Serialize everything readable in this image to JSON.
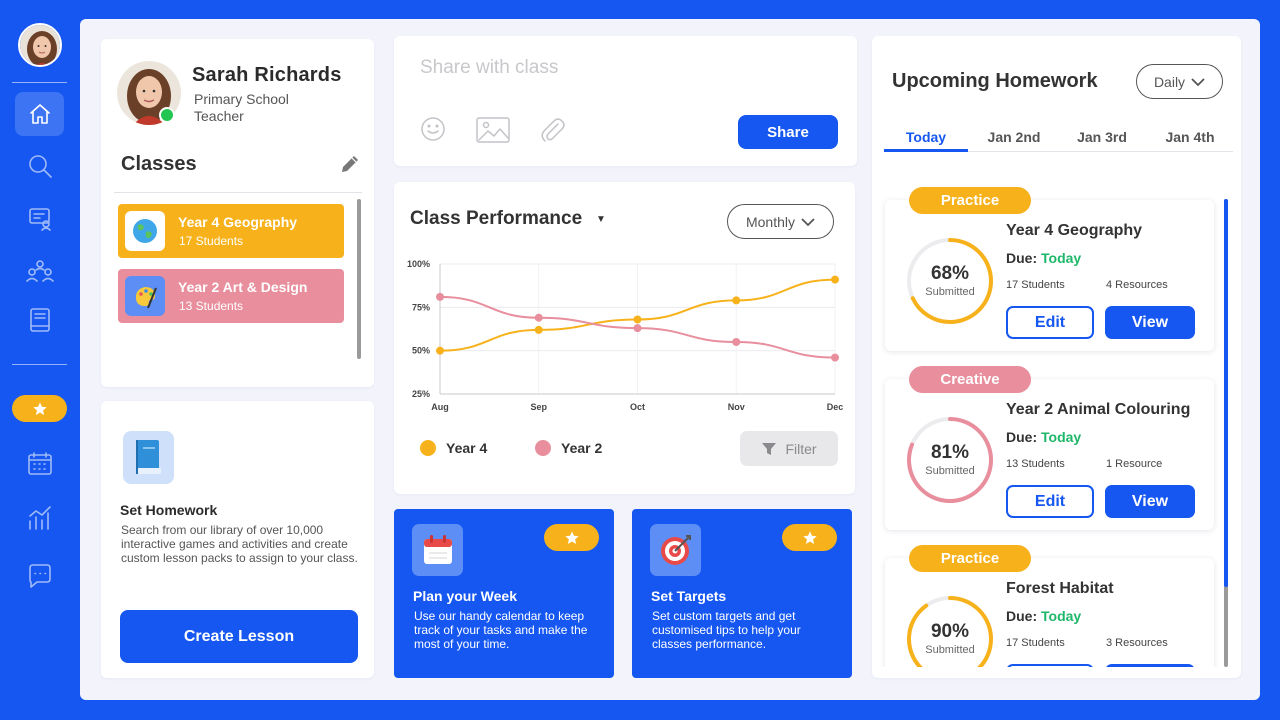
{
  "colors": {
    "brand": "#1557f0",
    "yellow": "#f7b21b",
    "pink": "#e88e9d",
    "green": "#1fb76a"
  },
  "sidebar": {
    "items": [
      {
        "icon": "home-icon",
        "active": true
      },
      {
        "icon": "search-icon",
        "active": false
      },
      {
        "icon": "classroom-icon",
        "active": false
      },
      {
        "icon": "students-icon",
        "active": false
      },
      {
        "icon": "book-icon",
        "active": false
      },
      {
        "icon": "calendar-icon",
        "active": false
      },
      {
        "icon": "analytics-icon",
        "active": false
      },
      {
        "icon": "chat-icon",
        "active": false
      }
    ]
  },
  "profile": {
    "name": "Sarah Richards",
    "role": "Primary School Teacher",
    "classes_title": "Classes",
    "classes": [
      {
        "name": "Year 4 Geography",
        "count": "17 Students",
        "color": "#f7b21b",
        "icon": "globe-icon"
      },
      {
        "name": "Year 2 Art & Design",
        "count": "13 Students",
        "color": "#e88e9d",
        "icon": "palette-icon"
      }
    ]
  },
  "homework_card": {
    "title": "Set Homework",
    "description": "Search from our library of over 10,000 interactive games and activities and create custom lesson packs to assign to your class.",
    "button": "Create Lesson"
  },
  "share": {
    "placeholder": "Share with class",
    "button": "Share"
  },
  "performance": {
    "title": "Class Performance",
    "period": "Monthly",
    "filter": "Filter"
  },
  "chart_data": {
    "type": "line",
    "title": "Class Performance",
    "categories": [
      "Aug",
      "Sep",
      "Oct",
      "Nov",
      "Dec"
    ],
    "x": [
      0,
      1,
      2,
      3,
      4,
      5,
      6,
      7,
      8
    ],
    "series": [
      {
        "name": "Year 4",
        "color": "#f7b21b",
        "values": [
          50,
          62,
          68,
          79,
          91
        ]
      },
      {
        "name": "Year 2",
        "color": "#e88e9d",
        "values": [
          81,
          69,
          63,
          55,
          46
        ]
      }
    ],
    "y_ticks": [
      "100%",
      "75%",
      "50%",
      "25%"
    ],
    "ylim": [
      25,
      100
    ],
    "grid": true,
    "legend": "bottom-left"
  },
  "tiles": [
    {
      "title": "Plan your Week",
      "description": "Use our handy calendar to keep track of your tasks and make the most of your time.",
      "icon": "calendar-icon"
    },
    {
      "title": "Set Targets",
      "description": "Set custom targets and get customised tips to help your classes performance.",
      "icon": "target-icon"
    }
  ],
  "upcoming": {
    "title": "Upcoming Homework",
    "period": "Daily",
    "tabs": [
      "Today",
      "Jan 2nd",
      "Jan 3rd",
      "Jan 4th"
    ],
    "due_label": "Due:",
    "edit": "Edit",
    "view": "View",
    "items": [
      {
        "tag": "Practice",
        "tag_color": "#f7b21b",
        "percent": "68%",
        "progress": 0.68,
        "submitted": "Submitted",
        "name": "Year 4 Geography",
        "due": "Today",
        "students": "17 Students",
        "resources": "4 Resources"
      },
      {
        "tag": "Creative",
        "tag_color": "#e88e9d",
        "percent": "81%",
        "progress": 0.81,
        "submitted": "Submitted",
        "name": "Year 2 Animal Colouring",
        "due": "Today",
        "students": "13 Students",
        "resources": "1 Resource"
      },
      {
        "tag": "Practice",
        "tag_color": "#f7b21b",
        "percent": "90%",
        "progress": 0.9,
        "submitted": "Submitted",
        "name": "Forest Habitat",
        "due": "Today",
        "students": "17 Students",
        "resources": "3 Resources"
      }
    ]
  }
}
